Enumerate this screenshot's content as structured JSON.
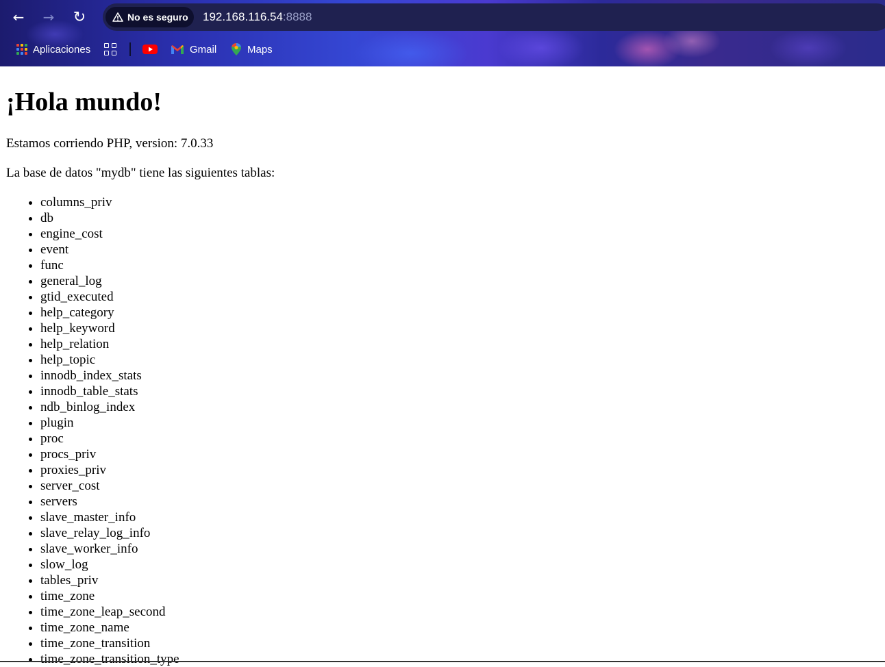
{
  "browser": {
    "nav": {
      "back": "←",
      "forward": "→",
      "reload": "↻"
    },
    "security_chip": "No es seguro",
    "url_host": "192.168.116.54",
    "url_port": ":8888",
    "bookmarks": [
      {
        "label": "Aplicaciones",
        "icon": "apps-grid-icon"
      },
      {
        "label": "",
        "icon": "tab-groups-icon"
      },
      {
        "label": "",
        "icon": "youtube-icon"
      },
      {
        "label": "Gmail",
        "icon": "gmail-icon"
      },
      {
        "label": "Maps",
        "icon": "maps-icon"
      }
    ],
    "colors": {
      "omnibox_bg": "#1f2150",
      "chip_bg": "#0e0f2e",
      "youtube_red": "#ff0000",
      "gmail_red": "#ea4335",
      "maps_green": "#34a853"
    }
  },
  "page": {
    "heading": "¡Hola mundo!",
    "php_line": "Estamos corriendo PHP, version: 7.0.33",
    "db_line": "La base de datos \"mydb\" tiene las siguientes tablas:",
    "tables": [
      "columns_priv",
      "db",
      "engine_cost",
      "event",
      "func",
      "general_log",
      "gtid_executed",
      "help_category",
      "help_keyword",
      "help_relation",
      "help_topic",
      "innodb_index_stats",
      "innodb_table_stats",
      "ndb_binlog_index",
      "plugin",
      "proc",
      "procs_priv",
      "proxies_priv",
      "server_cost",
      "servers",
      "slave_master_info",
      "slave_relay_log_info",
      "slave_worker_info",
      "slow_log",
      "tables_priv",
      "time_zone",
      "time_zone_leap_second",
      "time_zone_name",
      "time_zone_transition",
      "time_zone_transition_type"
    ]
  }
}
